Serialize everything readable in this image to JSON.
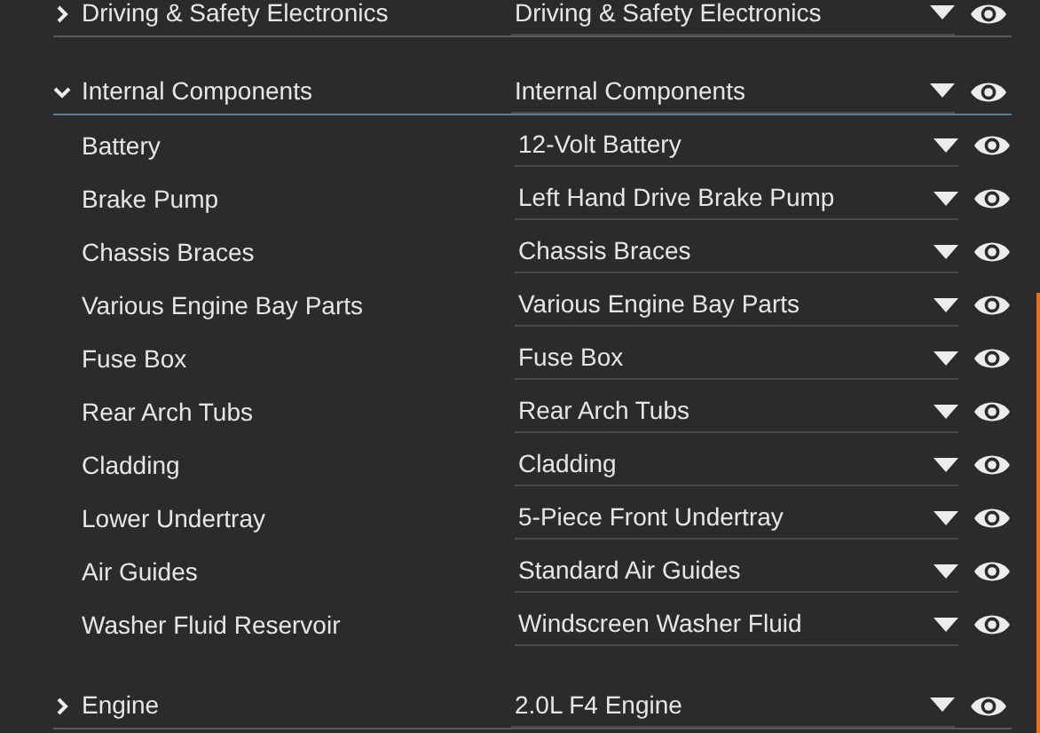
{
  "groups": [
    {
      "label": "Driving & Safety Electronics",
      "value": "Driving & Safety Electronics",
      "expanded": false
    },
    {
      "label": "Internal Components",
      "value": "Internal Components",
      "expanded": true,
      "children": [
        {
          "label": "Battery",
          "value": "12-Volt Battery"
        },
        {
          "label": "Brake Pump",
          "value": "Left Hand Drive Brake Pump"
        },
        {
          "label": "Chassis Braces",
          "value": "Chassis Braces"
        },
        {
          "label": "Various Engine Bay Parts",
          "value": "Various Engine Bay Parts"
        },
        {
          "label": "Fuse Box",
          "value": "Fuse Box"
        },
        {
          "label": "Rear Arch Tubs",
          "value": "Rear Arch Tubs"
        },
        {
          "label": "Cladding",
          "value": "Cladding"
        },
        {
          "label": "Lower Undertray",
          "value": "5-Piece Front Undertray"
        },
        {
          "label": "Air Guides",
          "value": "Standard Air Guides"
        },
        {
          "label": "Washer Fluid Reservoir",
          "value": "Windscreen Washer Fluid"
        }
      ]
    },
    {
      "label": "Engine",
      "value": "2.0L F4 Engine",
      "expanded": false
    }
  ]
}
